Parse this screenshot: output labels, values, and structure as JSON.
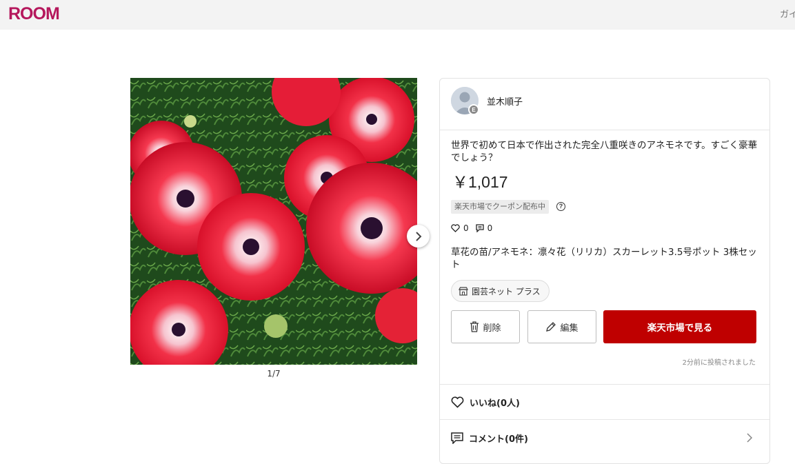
{
  "header": {
    "logo": "ROOM",
    "guide_label": "ガイド"
  },
  "media": {
    "pager": "1/7",
    "image_alt": "red double anemone flowers"
  },
  "post": {
    "username": "並木順子",
    "badge": "E",
    "description": "世界で初めて日本で作出された完全八重咲きのアネモネです。すごく豪華でしょう？",
    "price": "￥1,017",
    "coupon": "楽天市場でクーポン配布中",
    "help": "?",
    "likes_count": "0",
    "comments_count": "0",
    "product_name": "草花の苗/アネモネ：凛々花（リリカ）スカーレット3.5号ポット 3株セット",
    "shop_name": "園芸ネット プラス",
    "posted_time": "2分前に投稿されました"
  },
  "actions": {
    "delete_label": "削除",
    "edit_label": "編集",
    "rakuten_label": "楽天市場で見る"
  },
  "social": {
    "like_label": "いいね(0人)",
    "comment_label": "コメント(0件)"
  },
  "colors": {
    "brand": "#b5175c",
    "rakuten_red": "#bf0000"
  },
  "icons": [
    "chevron-right-icon",
    "heart-icon",
    "comment-icon",
    "shop-icon",
    "trash-icon",
    "pencil-icon",
    "help-icon",
    "avatar-icon"
  ]
}
